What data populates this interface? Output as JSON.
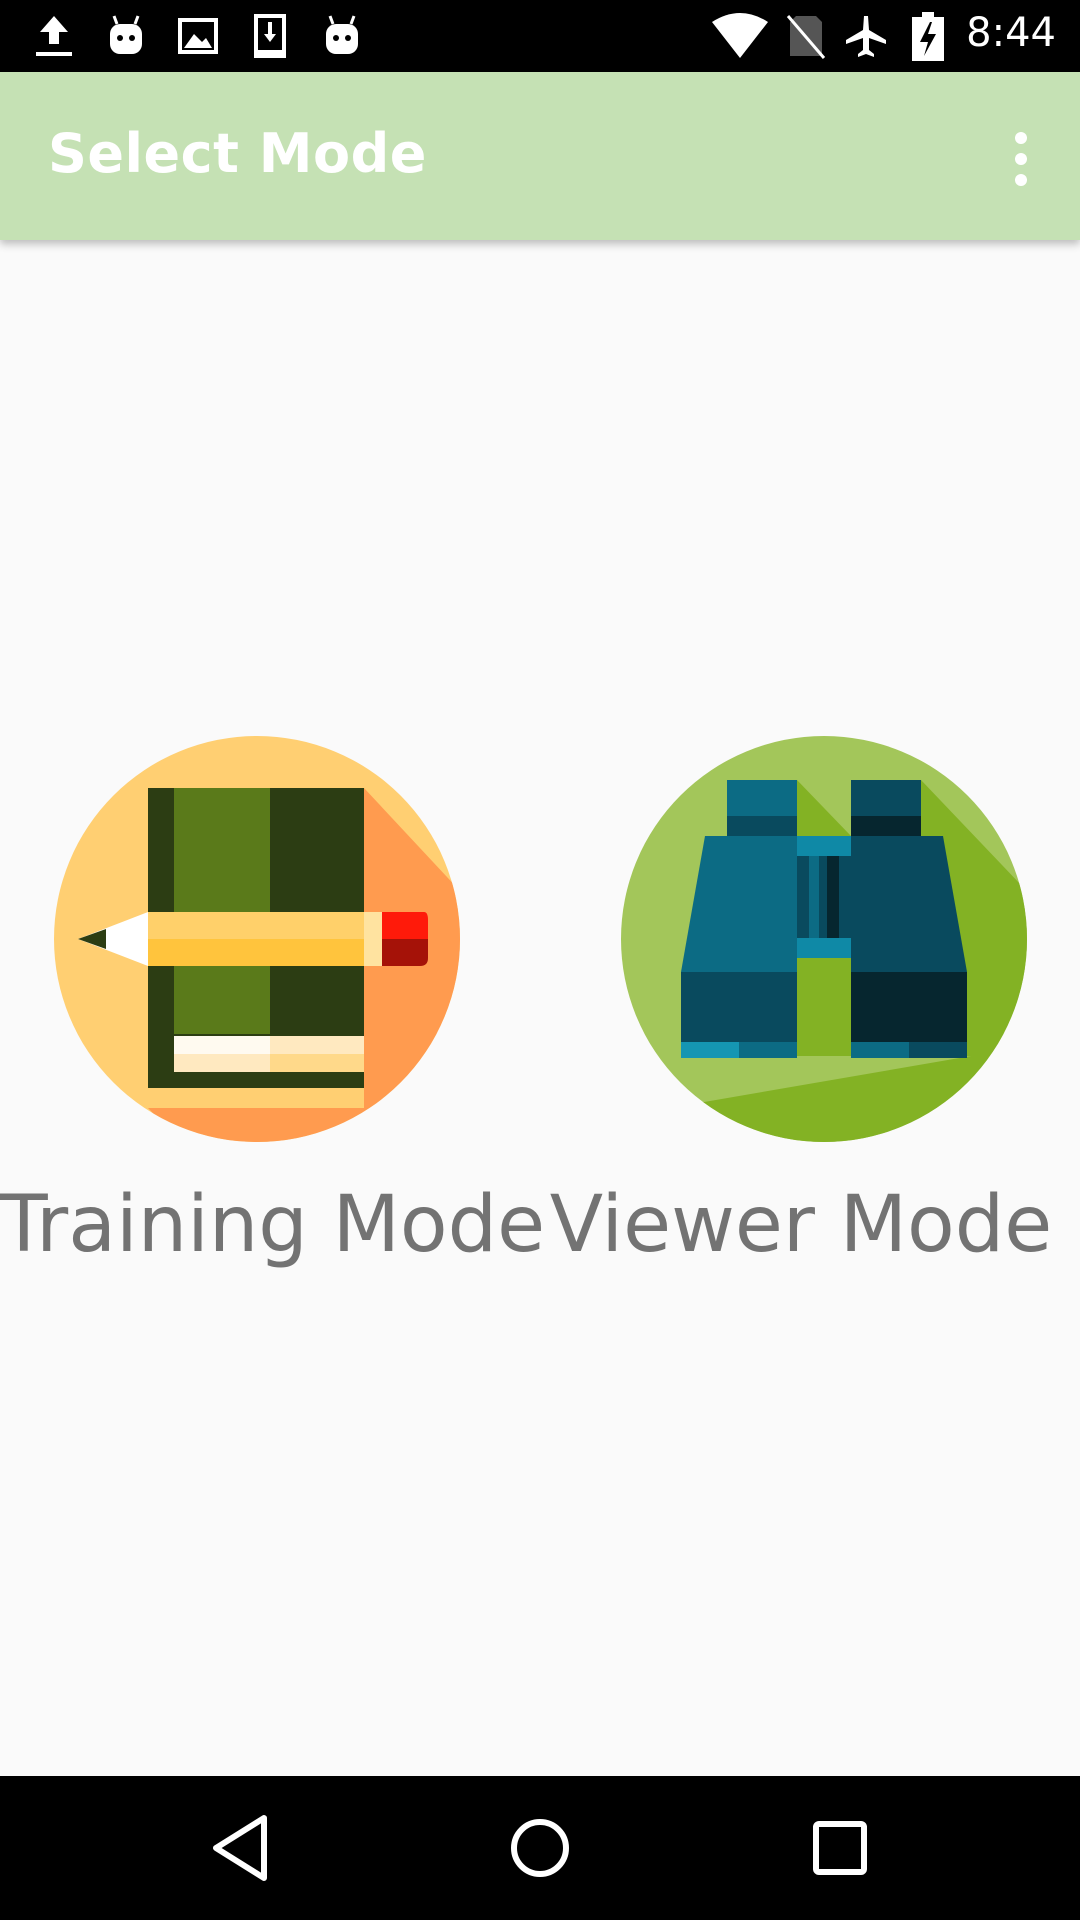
{
  "status_bar": {
    "time": "8:44",
    "left_icons": [
      "upload-icon",
      "android-icon",
      "image-icon",
      "download-icon",
      "android-icon"
    ],
    "right_icons": [
      "wifi-icon",
      "no-sim-icon",
      "airplane-icon",
      "battery-charging-icon"
    ]
  },
  "app_bar": {
    "title": "Select Mode",
    "background": "#c5e1b4",
    "overflow_icon": "more-vert-icon"
  },
  "modes": [
    {
      "label": "Training Mode",
      "icon": "book-pencil-icon"
    },
    {
      "label": "Viewer Mode",
      "icon": "binoculars-icon"
    }
  ],
  "nav_bar": {
    "buttons": [
      "back-icon",
      "home-icon",
      "recents-icon"
    ]
  }
}
